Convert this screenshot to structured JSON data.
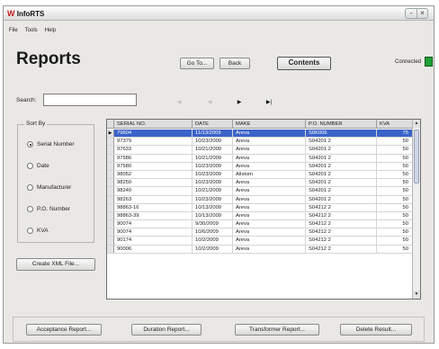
{
  "window": {
    "app_title": "InfoRTS",
    "controls": [
      "-",
      "×"
    ]
  },
  "menu": [
    "File",
    "Tools",
    "Help"
  ],
  "page_title": "Reports",
  "toolbar": {
    "goto_label": "Go To...",
    "back_label": "Back",
    "contents_label": "Contents"
  },
  "connection": {
    "label": "Connected",
    "status_color": "#21a038"
  },
  "search": {
    "label": "Search:",
    "value": ""
  },
  "nav": {
    "first_icon": "first-record-icon",
    "prev_icon": "previous-record-icon",
    "next_icon": "next-record-icon",
    "last_icon": "last-record-icon",
    "first": "◀",
    "prev": "◀",
    "next": "▶",
    "last": "▶|"
  },
  "sort": {
    "legend": "Sort By",
    "options": [
      "Serial Number",
      "Date",
      "Manufacturer",
      "P.O. Number",
      "KVA"
    ],
    "selected": 0
  },
  "export_label": "Create XML File...",
  "grid": {
    "columns": [
      "SERIAL NO.",
      "DATE",
      "MAKE",
      "P.O. NUMBER",
      "KVA"
    ],
    "rows": [
      [
        "79604",
        "11/13/2009",
        "Areva",
        "S0K006",
        "75"
      ],
      [
        "97379",
        "10/23/2009",
        "Areva",
        "S04201 2",
        "50"
      ],
      [
        "97633",
        "10/21/2009",
        "Areva",
        "S04201 2",
        "50"
      ],
      [
        "97586",
        "10/21/2009",
        "Areva",
        "S04201 2",
        "50"
      ],
      [
        "97580",
        "10/23/2009",
        "Areva",
        "S04201 2",
        "50"
      ],
      [
        "98052",
        "10/23/2009",
        "Allstom",
        "S04201 2",
        "50"
      ],
      [
        "98250",
        "10/23/2009",
        "Areva",
        "S04201 2",
        "50"
      ],
      [
        "98240",
        "10/21/2009",
        "Areva",
        "S04201 2",
        "50"
      ],
      [
        "98263",
        "10/23/2009",
        "Areva",
        "S04201 2",
        "50"
      ],
      [
        "98863-16",
        "10/13/2009",
        "Areva",
        "S04212 2",
        "50"
      ],
      [
        "98863-39",
        "10/13/2009",
        "Areva",
        "S04212 2",
        "50"
      ],
      [
        "90074",
        "9/30/2009",
        "Areva",
        "S04212 2",
        "50"
      ],
      [
        "90074",
        "10/6/2009",
        "Areva",
        "S04212 2",
        "50"
      ],
      [
        "90174",
        "10/2/2009",
        "Areva",
        "S04212 2",
        "50"
      ],
      [
        "90006",
        "10/2/2009",
        "Areva",
        "S04212 2",
        "50"
      ]
    ],
    "selected_row": 0
  },
  "scroll": {
    "up": "▲",
    "down": "▼"
  },
  "actions": {
    "acceptance": "Acceptance Report...",
    "duration": "Duration Report...",
    "transformer": "Transformer Report...",
    "delete": "Delete Result..."
  }
}
